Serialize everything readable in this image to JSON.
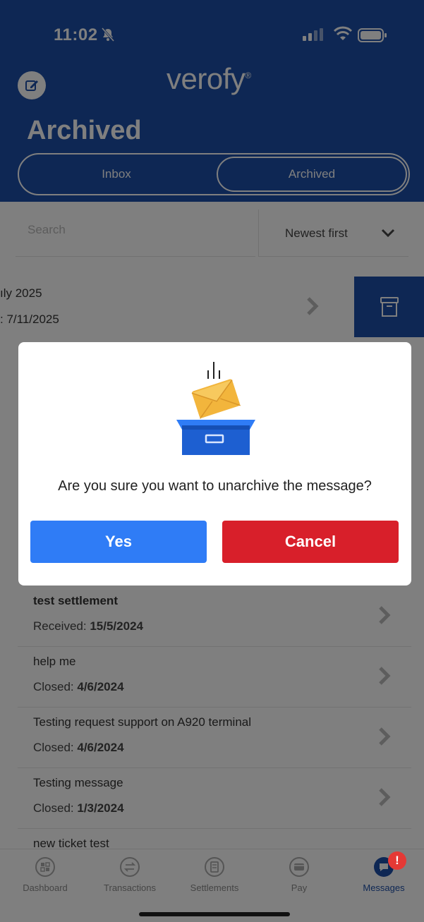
{
  "status_bar": {
    "time": "11:02",
    "icons": [
      "bell-slash-icon",
      "signal-icon",
      "wifi-icon",
      "battery-icon"
    ]
  },
  "header": {
    "logo": "verofy",
    "logo_mark": "®",
    "title": "Archived",
    "compose_icon": "compose-icon"
  },
  "segments": {
    "inbox": "Inbox",
    "archived": "Archived",
    "selected": "Archived"
  },
  "filters": {
    "search_placeholder": "Search",
    "sort_label": "Newest first"
  },
  "swiped_row": {
    "line1": "ıly 2025",
    "line2": ": 7/11/2025",
    "action_icon": "archive-box-icon"
  },
  "messages": [
    {
      "title": "test settlement",
      "meta_label": "Received:",
      "meta_value": "15/5/2024",
      "bold": true
    },
    {
      "title": "help me",
      "meta_label": "Closed:",
      "meta_value": "4/6/2024",
      "bold": false
    },
    {
      "title": "Testing request support on A920 terminal",
      "meta_label": "Closed:",
      "meta_value": "4/6/2024",
      "bold": false
    },
    {
      "title": "Testing message",
      "meta_label": "Closed:",
      "meta_value": "1/3/2024",
      "bold": false
    },
    {
      "title": "new ticket test",
      "meta_label": "",
      "meta_value": "",
      "bold": false
    }
  ],
  "tabbar": {
    "items": [
      {
        "label": "Dashboard",
        "icon": "dashboard-icon"
      },
      {
        "label": "Transactions",
        "icon": "transactions-icon"
      },
      {
        "label": "Settlements",
        "icon": "settlements-icon"
      },
      {
        "label": "Pay",
        "icon": "card-icon"
      },
      {
        "label": "Messages",
        "icon": "chat-icon",
        "active": true
      }
    ],
    "badge": "!"
  },
  "dialog": {
    "message": "Are you sure you want to unarchive the message?",
    "yes_label": "Yes",
    "cancel_label": "Cancel"
  },
  "colors": {
    "brand": "#1d4fa8",
    "yes": "#2f7cf6",
    "cancel": "#d81f2a",
    "badge": "#e53935"
  }
}
